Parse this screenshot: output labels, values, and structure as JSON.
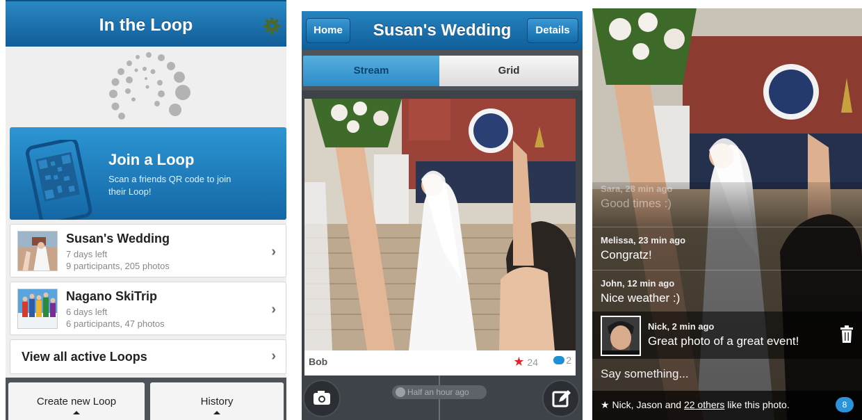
{
  "screen1": {
    "title": "In the Loop",
    "join": {
      "title": "Join a Loop",
      "description": "Scan a friends QR code to join their Loop!"
    },
    "loops": [
      {
        "name": "Susan's Wedding",
        "days_left": "7 days left",
        "stats": "9 participants, 205 photos"
      },
      {
        "name": "Nagano SkiTrip",
        "days_left": "6 days left",
        "stats": "6 participants, 47 photos"
      }
    ],
    "view_all": "View all active Loops",
    "bottom": {
      "create": "Create new Loop",
      "history": "History"
    },
    "icons": [
      "gear-icon",
      "qr-phone-icon",
      "chevron-right-icon"
    ]
  },
  "screen2": {
    "title": "Susan's Wedding",
    "home_label": "Home",
    "details_label": "Details",
    "tabs": {
      "stream": "Stream",
      "grid": "Grid"
    },
    "post": {
      "author": "Bob",
      "likes": "24",
      "comments": "2"
    },
    "time_label": "Half an hour ago",
    "icons": [
      "camera-icon",
      "compose-icon",
      "star-icon",
      "comment-icon"
    ]
  },
  "screen3": {
    "comments": [
      {
        "who": "Sara, 28 min ago",
        "text": "Good times :)"
      },
      {
        "who": "Melissa, 23 min ago",
        "text": "Congratz!"
      },
      {
        "who": "John, 12 min ago",
        "text": "Nice weather :)"
      }
    ],
    "mine": {
      "who": "Nick, 2 min ago",
      "text": "Great photo of a great event!"
    },
    "input_placeholder": "Say something...",
    "likes": {
      "prefix": "Nick, Jason and ",
      "others": "22 others",
      "suffix": " like this photo."
    },
    "badge": "8",
    "icons": [
      "trash-icon",
      "star-icon"
    ]
  },
  "colors": {
    "brand_blue": "#1467a5",
    "accent_red": "#d9252b",
    "badge_blue": "#2a93d9"
  }
}
